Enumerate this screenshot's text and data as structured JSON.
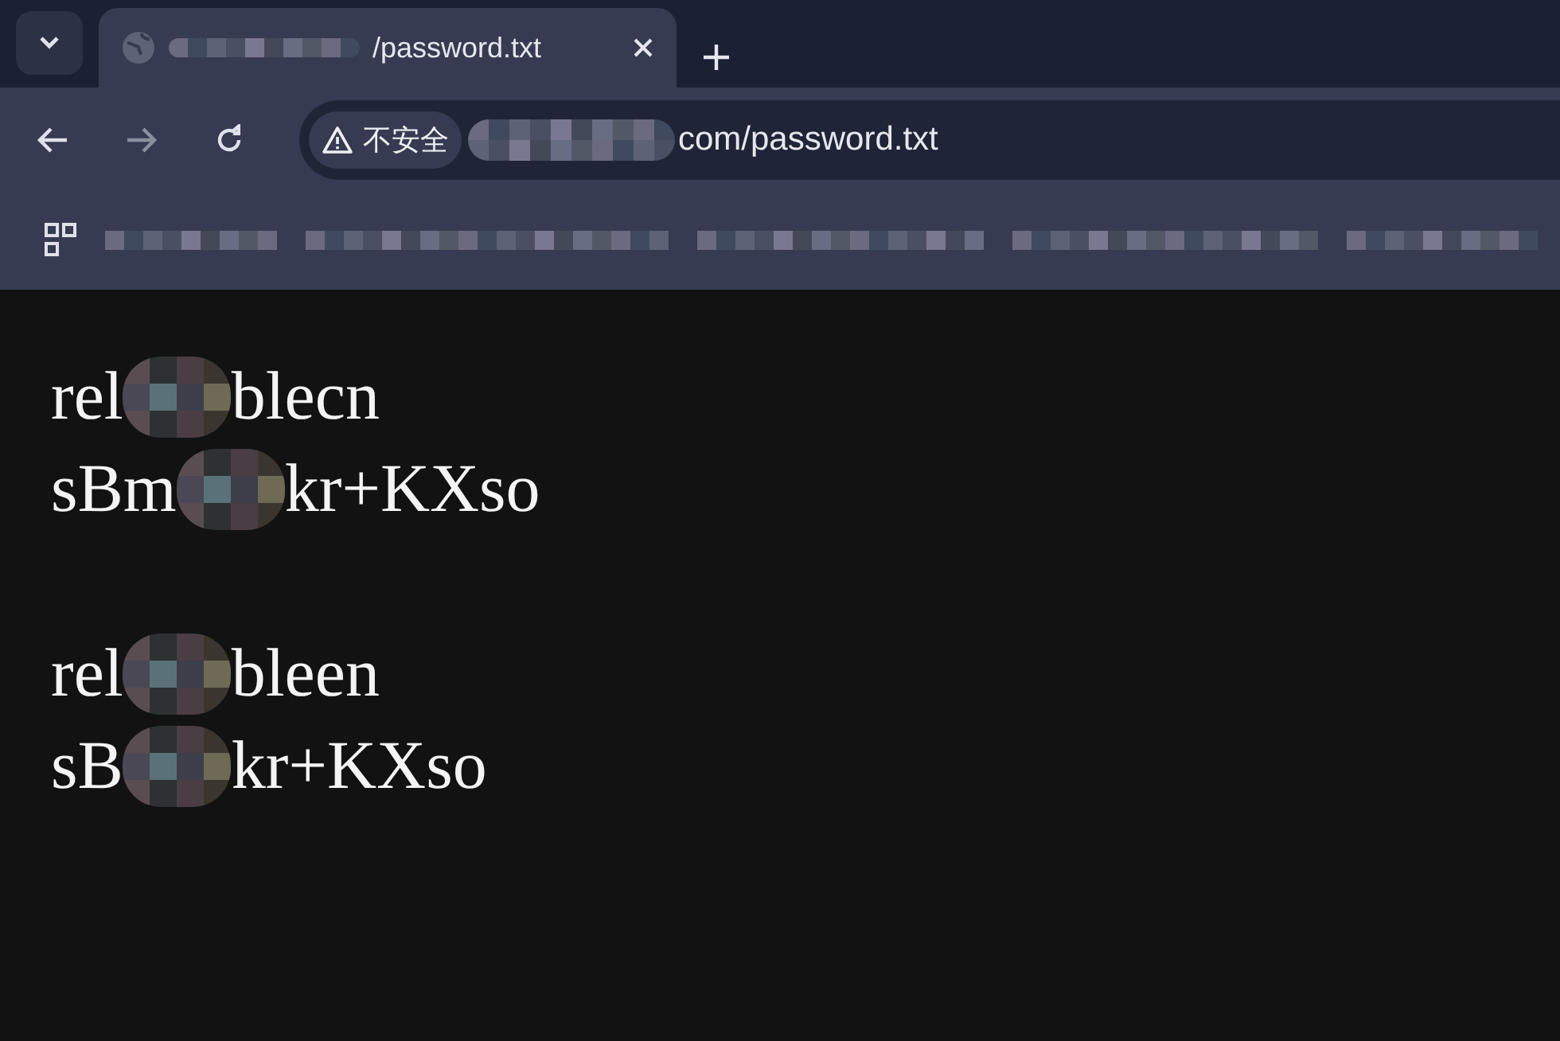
{
  "tab": {
    "title": "/password.txt",
    "selected": true
  },
  "address_bar": {
    "security_label": "不安全",
    "url": "com/password.txt"
  },
  "document": {
    "lines": [
      {
        "kind": "text",
        "before": "rel",
        "after": "blecn"
      },
      {
        "kind": "text",
        "before": "sBm",
        "after": "kr+KXso"
      },
      {
        "kind": "blank"
      },
      {
        "kind": "text",
        "before": "rel",
        "after": "bleen"
      },
      {
        "kind": "text",
        "before": "sB",
        "after": "kr+KXso"
      }
    ]
  }
}
